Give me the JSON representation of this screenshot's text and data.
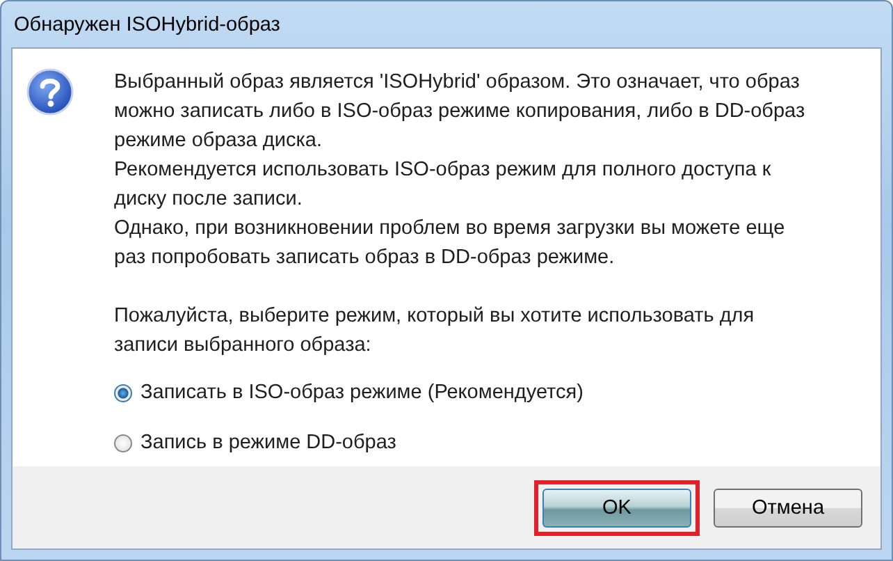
{
  "window": {
    "title": "Обнаружен ISOHybrid-образ"
  },
  "message": {
    "paragraphs": [
      "Выбранный образ является 'ISOHybrid' образом. Это означает, что образ можно записать либо в ISO-образ режиме копирования, либо в DD-образ режиме образа диска.",
      "Рекомендуется использовать ISO-образ режим для полного доступа к диску после записи.",
      "Однако, при возникновении проблем во время загрузки вы можете еще раз попробовать записать образ в DD-образ режиме."
    ],
    "prompt": "Пожалуйста, выберите режим, который вы хотите использовать для записи выбранного образа:"
  },
  "options": [
    {
      "label": "Записать в ISO-образ режиме (Рекомендуется)",
      "selected": true
    },
    {
      "label": "Запись в режиме DD-образ",
      "selected": false
    }
  ],
  "buttons": [
    {
      "label": "OK",
      "highlighted": true
    },
    {
      "label": "Отмена",
      "highlighted": false
    }
  ]
}
